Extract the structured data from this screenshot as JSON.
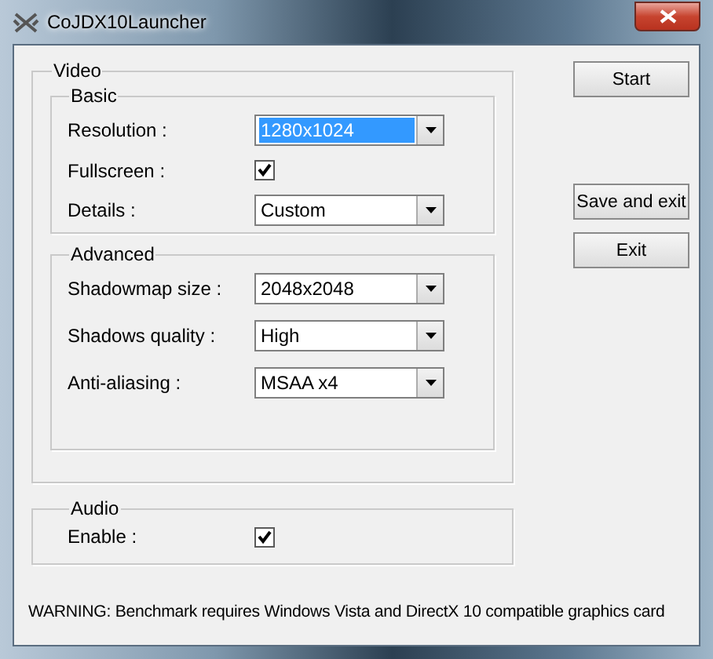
{
  "window": {
    "title": "CoJDX10Launcher"
  },
  "video": {
    "label": "Video",
    "groups": [
      {
        "label": "Basic",
        "rows": [
          {
            "kind": "select",
            "label": "Resolution :",
            "value": "1280x1024",
            "focused": true
          },
          {
            "kind": "checkbox",
            "label": "Fullscreen :",
            "checked": true
          },
          {
            "kind": "select",
            "label": "Details :",
            "value": "Custom",
            "focused": false
          }
        ]
      },
      {
        "label": "Advanced",
        "rows": [
          {
            "kind": "select",
            "label": "Shadowmap size :",
            "value": "2048x2048",
            "focused": false
          },
          {
            "kind": "select",
            "label": "Shadows quality :",
            "value": "High",
            "focused": false
          },
          {
            "kind": "select",
            "label": "Anti-aliasing :",
            "value": "MSAA x4",
            "focused": false
          }
        ]
      }
    ]
  },
  "audio": {
    "label": "Audio",
    "rows": [
      {
        "kind": "checkbox",
        "label": "Enable :",
        "checked": true
      }
    ]
  },
  "buttons": [
    "Start",
    "Save and exit",
    "Exit"
  ],
  "warning": "WARNING: Benchmark requires Windows Vista and DirectX 10 compatible graphics card"
}
